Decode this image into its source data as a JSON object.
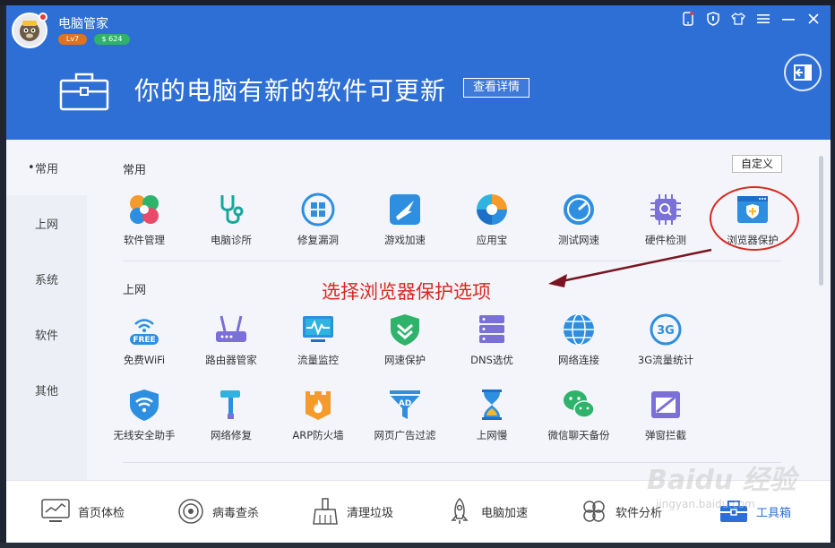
{
  "app": {
    "title": "电脑管家",
    "level": "Lv7",
    "coins": "$ 624"
  },
  "window_controls": [
    "phone-icon",
    "shield-icon",
    "shirt-icon",
    "menu-icon",
    "minimize-icon",
    "close-icon"
  ],
  "banner": {
    "message": "你的电脑有新的软件可更新",
    "detail_button": "查看详情"
  },
  "sidebar": {
    "items": [
      {
        "label": "常用",
        "active": true
      },
      {
        "label": "上网",
        "active": false
      },
      {
        "label": "系统",
        "active": false
      },
      {
        "label": "软件",
        "active": false
      },
      {
        "label": "其他",
        "active": false
      }
    ]
  },
  "content": {
    "custom_button": "自定义",
    "sections": [
      {
        "title": "常用",
        "tools": [
          {
            "label": "软件管理",
            "icon": "clover-icon"
          },
          {
            "label": "电脑诊所",
            "icon": "stethoscope-icon"
          },
          {
            "label": "修复漏洞",
            "icon": "windows-repair-icon"
          },
          {
            "label": "游戏加速",
            "icon": "game-boost-icon"
          },
          {
            "label": "应用宝",
            "icon": "app-store-icon"
          },
          {
            "label": "测试网速",
            "icon": "speedometer-icon"
          },
          {
            "label": "硬件检测",
            "icon": "chip-icon"
          },
          {
            "label": "浏览器保护",
            "icon": "browser-shield-icon"
          }
        ]
      },
      {
        "title": "上网",
        "tools": [
          {
            "label": "免费WiFi",
            "icon": "free-wifi-icon"
          },
          {
            "label": "路由器管家",
            "icon": "router-icon"
          },
          {
            "label": "流量监控",
            "icon": "traffic-monitor-icon"
          },
          {
            "label": "网速保护",
            "icon": "speed-shield-icon"
          },
          {
            "label": "DNS选优",
            "icon": "dns-server-icon"
          },
          {
            "label": "网络连接",
            "icon": "globe-icon"
          },
          {
            "label": "3G流量统计",
            "icon": "3g-icon"
          },
          {
            "label": "无线安全助手",
            "icon": "wifi-shield-icon"
          },
          {
            "label": "网络修复",
            "icon": "hammer-icon"
          },
          {
            "label": "ARP防火墙",
            "icon": "firewall-icon"
          },
          {
            "label": "网页广告过滤",
            "icon": "ad-filter-icon"
          },
          {
            "label": "上网慢",
            "icon": "hourglass-icon"
          },
          {
            "label": "微信聊天备份",
            "icon": "wechat-icon"
          },
          {
            "label": "弹窗拦截",
            "icon": "popup-block-icon"
          }
        ]
      }
    ]
  },
  "annotation": {
    "text": "选择浏览器保护选项",
    "color": "#d9281f"
  },
  "bottom_nav": {
    "items": [
      {
        "label": "首页体检",
        "icon": "monitor-chart-icon"
      },
      {
        "label": "病毒查杀",
        "icon": "target-icon"
      },
      {
        "label": "清理垃圾",
        "icon": "broom-icon"
      },
      {
        "label": "电脑加速",
        "icon": "rocket-icon"
      },
      {
        "label": "软件分析",
        "icon": "clover-outline-icon"
      },
      {
        "label": "工具箱",
        "icon": "toolbox-icon",
        "active": true
      }
    ]
  },
  "watermark": {
    "text": "Baidu 经验",
    "sub": "jingyan.baidu.com"
  },
  "colors": {
    "header_blue": "#2e6fd6",
    "accent_red": "#d9281f",
    "background": "#f3f5fb"
  }
}
